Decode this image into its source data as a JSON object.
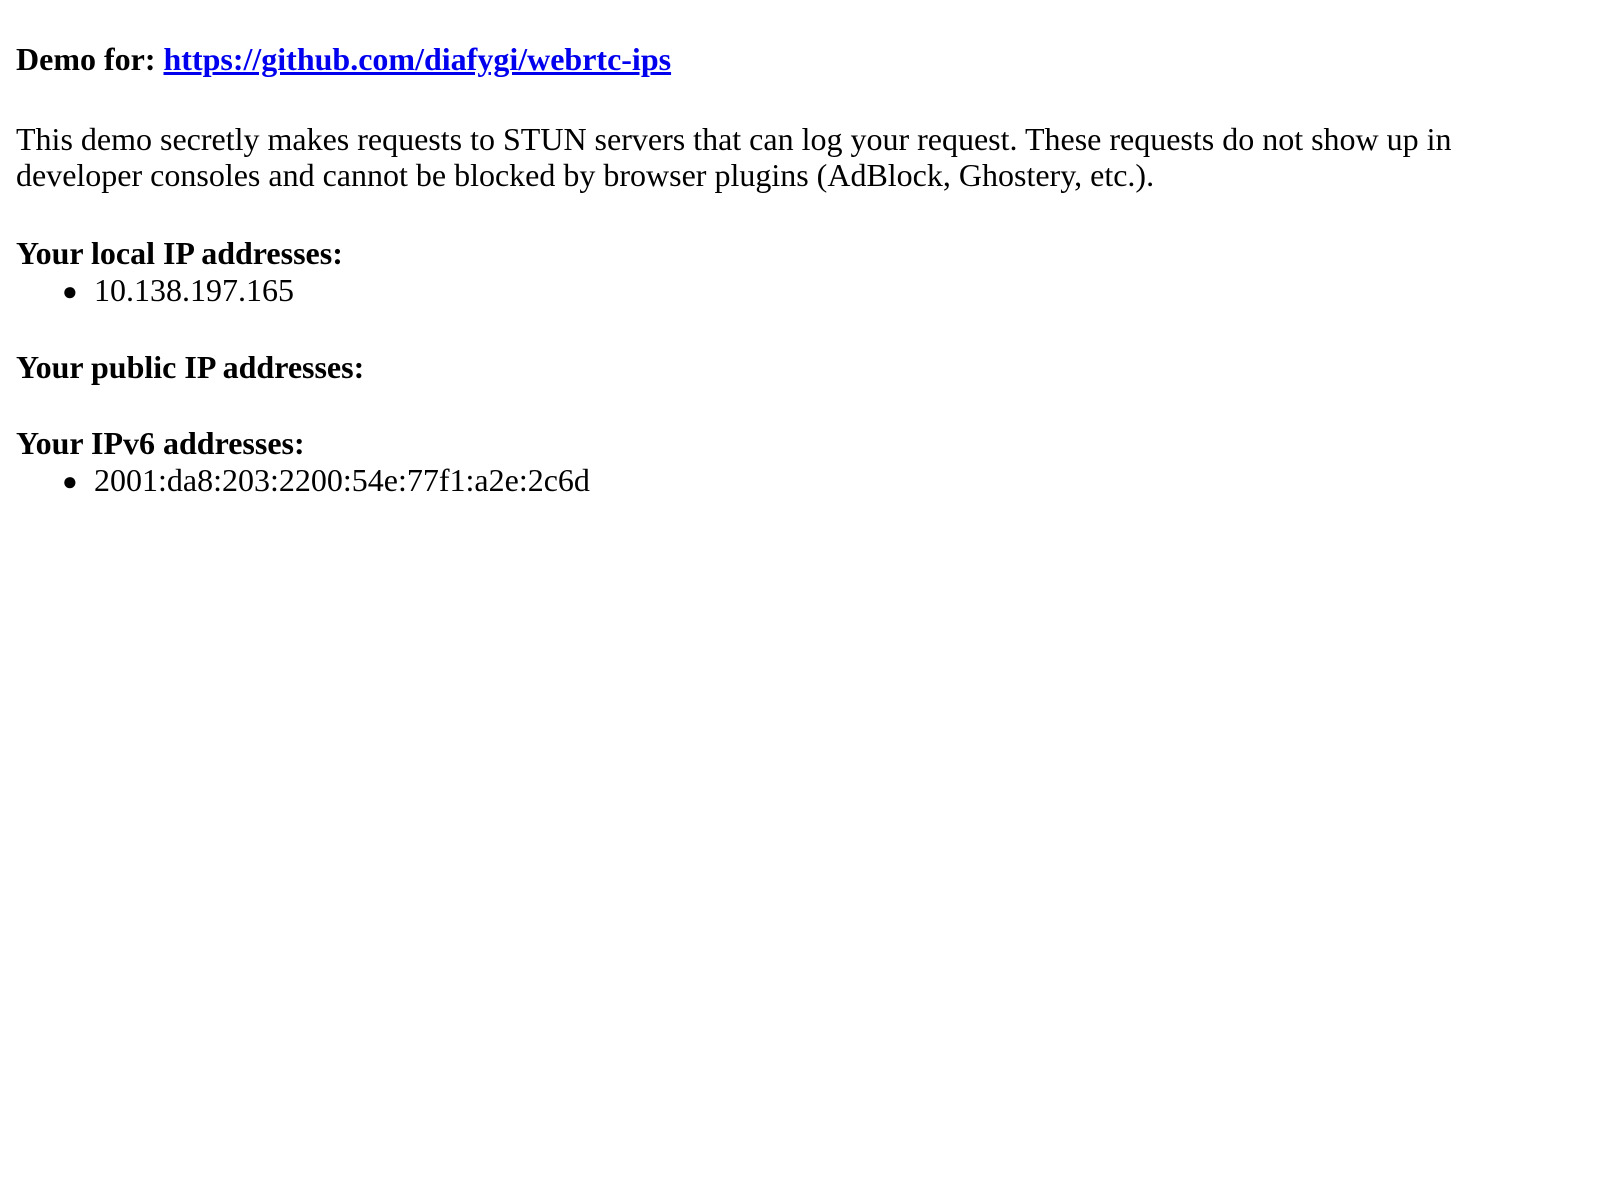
{
  "demo": {
    "label": "Demo for:",
    "link_text": "https://github.com/diafygi/webrtc-ips",
    "link_href": "https://github.com/diafygi/webrtc-ips"
  },
  "description": "This demo secretly makes requests to STUN servers that can log your request. These requests do not show up in developer consoles and cannot be blocked by browser plugins (AdBlock, Ghostery, etc.).",
  "local": {
    "heading": "Your local IP addresses:",
    "addresses": [
      "10.138.197.165"
    ]
  },
  "public": {
    "heading": "Your public IP addresses:",
    "addresses": []
  },
  "ipv6": {
    "heading": "Your IPv6 addresses:",
    "addresses": [
      "2001:da8:203:2200:54e:77f1:a2e:2c6d"
    ]
  },
  "colors": {
    "link": "#0000ee",
    "text": "#000000",
    "background": "#ffffff"
  }
}
